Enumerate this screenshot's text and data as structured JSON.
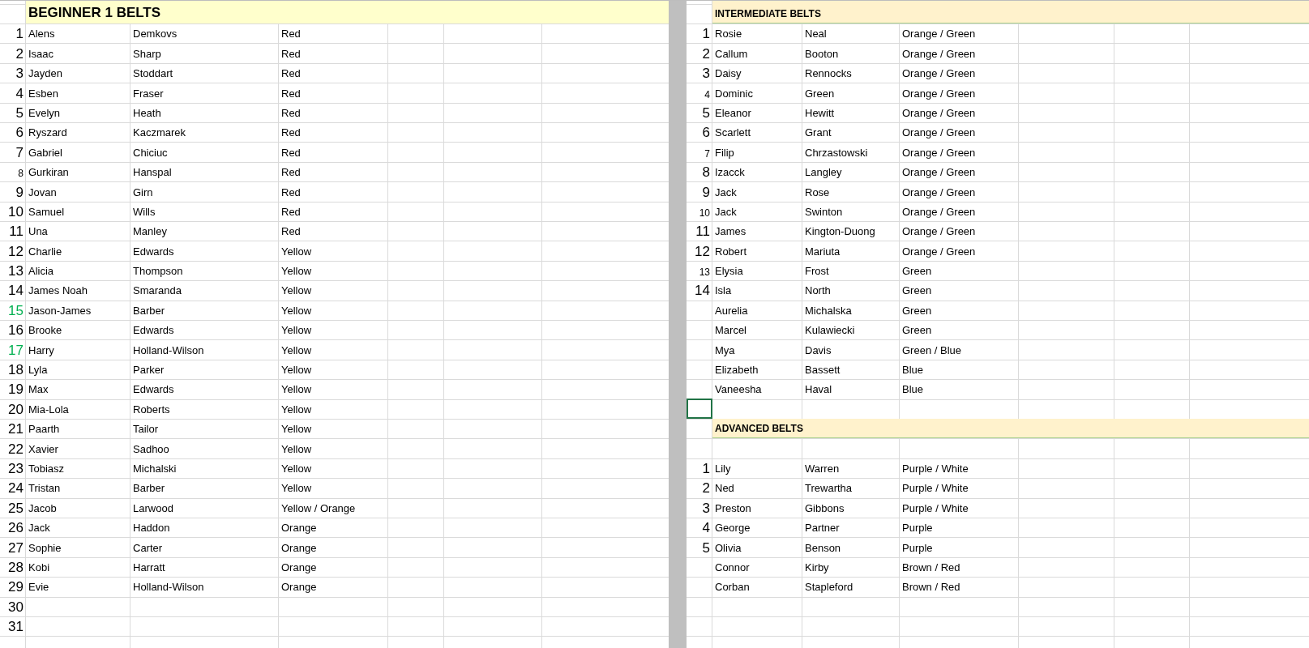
{
  "beginner": {
    "title": "BEGINNER 1 BELTS",
    "rows": [
      {
        "num": "1",
        "first": "Alens",
        "last": "Demkovs",
        "belt": "Red",
        "color": "#000000",
        "small": false
      },
      {
        "num": "2",
        "first": "Isaac",
        "last": "Sharp",
        "belt": "Red",
        "color": "#000000",
        "small": false
      },
      {
        "num": "3",
        "first": "Jayden",
        "last": "Stoddart",
        "belt": "Red",
        "color": "#000000",
        "small": false
      },
      {
        "num": "4",
        "first": "Esben",
        "last": "Fraser",
        "belt": "Red",
        "color": "#000000",
        "small": false
      },
      {
        "num": "5",
        "first": "Evelyn",
        "last": "Heath",
        "belt": "Red",
        "color": "#000000",
        "small": false
      },
      {
        "num": "6",
        "first": "Ryszard",
        "last": "Kaczmarek",
        "belt": "Red",
        "color": "#000000",
        "small": false
      },
      {
        "num": "7",
        "first": "Gabriel",
        "last": "Chiciuc",
        "belt": "Red",
        "color": "#000000",
        "small": false
      },
      {
        "num": "8",
        "first": "Gurkiran",
        "last": "Hanspal",
        "belt": "Red",
        "color": "#000000",
        "small": true
      },
      {
        "num": "9",
        "first": "Jovan",
        "last": "Girn",
        "belt": "Red",
        "color": "#000000",
        "small": false
      },
      {
        "num": "10",
        "first": "Samuel",
        "last": "Wills",
        "belt": "Red",
        "color": "#000000",
        "small": false
      },
      {
        "num": "11",
        "first": "Una",
        "last": "Manley",
        "belt": "Red",
        "color": "#000000",
        "small": false
      },
      {
        "num": "12",
        "first": "Charlie",
        "last": "Edwards",
        "belt": "Yellow",
        "color": "#000000",
        "small": false
      },
      {
        "num": "13",
        "first": "Alicia",
        "last": "Thompson",
        "belt": "Yellow",
        "color": "#000000",
        "small": false
      },
      {
        "num": "14",
        "first": "James Noah",
        "last": "Smaranda",
        "belt": "Yellow",
        "color": "#000000",
        "small": false
      },
      {
        "num": "15",
        "first": "Jason-James",
        "last": "Barber",
        "belt": "Yellow",
        "color": "#00b050",
        "small": false
      },
      {
        "num": "16",
        "first": "Brooke",
        "last": "Edwards",
        "belt": "Yellow",
        "color": "#000000",
        "small": false
      },
      {
        "num": "17",
        "first": "Harry",
        "last": "Holland-Wilson",
        "belt": "Yellow",
        "color": "#00b050",
        "small": false
      },
      {
        "num": "18",
        "first": "Lyla",
        "last": "Parker",
        "belt": "Yellow",
        "color": "#000000",
        "small": false
      },
      {
        "num": "19",
        "first": "Max",
        "last": "Edwards",
        "belt": "Yellow",
        "color": "#000000",
        "small": false
      },
      {
        "num": "20",
        "first": "Mia-Lola",
        "last": "Roberts",
        "belt": "Yellow",
        "color": "#000000",
        "small": false
      },
      {
        "num": "21",
        "first": "Paarth",
        "last": "Tailor",
        "belt": "Yellow",
        "color": "#000000",
        "small": false
      },
      {
        "num": "22",
        "first": "Xavier",
        "last": "Sadhoo",
        "belt": "Yellow",
        "color": "#000000",
        "small": false
      },
      {
        "num": "23",
        "first": "Tobiasz",
        "last": "Michalski",
        "belt": "Yellow",
        "color": "#000000",
        "small": false
      },
      {
        "num": "24",
        "first": "Tristan",
        "last": "Barber",
        "belt": "Yellow",
        "color": "#000000",
        "small": false
      },
      {
        "num": "25",
        "first": "Jacob",
        "last": "Larwood",
        "belt": "Yellow / Orange",
        "color": "#000000",
        "small": false
      },
      {
        "num": "26",
        "first": "Jack",
        "last": "Haddon",
        "belt": "Orange",
        "color": "#000000",
        "small": false
      },
      {
        "num": "27",
        "first": "Sophie",
        "last": "Carter",
        "belt": "Orange",
        "color": "#000000",
        "small": false
      },
      {
        "num": "28",
        "first": "Kobi",
        "last": "Harratt",
        "belt": "Orange",
        "color": "#000000",
        "small": false
      },
      {
        "num": "29",
        "first": "Evie",
        "last": "Holland-Wilson",
        "belt": "Orange",
        "color": "#000000",
        "small": false
      },
      {
        "num": "30",
        "color": "#000000",
        "small": false
      },
      {
        "num": "31",
        "color": "#000000",
        "small": false
      }
    ]
  },
  "intermediate": {
    "title": "INTERMEDIATE BELTS",
    "rows": [
      {
        "num": "1",
        "first": "Rosie",
        "last": "Neal",
        "belt": "Orange / Green",
        "small": false
      },
      {
        "num": "2",
        "first": "Callum",
        "last": "Booton",
        "belt": "Orange / Green",
        "small": false
      },
      {
        "num": "3",
        "first": "Daisy",
        "last": "Rennocks",
        "belt": "Orange / Green",
        "small": false
      },
      {
        "num": "4",
        "first": "Dominic",
        "last": "Green",
        "belt": "Orange / Green",
        "small": true
      },
      {
        "num": "5",
        "first": "Eleanor",
        "last": "Hewitt",
        "belt": "Orange / Green",
        "small": false
      },
      {
        "num": "6",
        "first": "Scarlett",
        "last": "Grant",
        "belt": "Orange / Green",
        "small": false
      },
      {
        "num": "7",
        "first": "Filip",
        "last": "Chrzastowski",
        "belt": "Orange / Green",
        "small": true
      },
      {
        "num": "8",
        "first": "Izacck",
        "last": "Langley",
        "belt": "Orange / Green",
        "small": false
      },
      {
        "num": "9",
        "first": "Jack",
        "last": "Rose",
        "belt": "Orange / Green",
        "small": false
      },
      {
        "num": "10",
        "first": "Jack",
        "last": "Swinton",
        "belt": "Orange / Green",
        "small": true
      },
      {
        "num": "11",
        "first": "James",
        "last": "Kington-Duong",
        "belt": "Orange / Green",
        "small": false
      },
      {
        "num": "12",
        "first": "Robert",
        "last": "Mariuta",
        "belt": "Orange / Green",
        "small": false
      },
      {
        "num": "13",
        "first": "Elysia",
        "last": "Frost",
        "belt": "Green",
        "small": true
      },
      {
        "num": "14",
        "first": "Isla",
        "last": "North",
        "belt": "Green",
        "small": false
      },
      {
        "first": "Aurelia",
        "last": "Michalska",
        "belt": "Green"
      },
      {
        "first": "Marcel",
        "last": "Kulawiecki",
        "belt": "Green"
      },
      {
        "first": "Mya",
        "last": "Davis",
        "belt": "Green / Blue"
      },
      {
        "first": "Elizabeth",
        "last": "Bassett",
        "belt": "Blue"
      },
      {
        "first": "Vaneesha",
        "last": "Haval",
        "belt": "Blue"
      }
    ],
    "blank_cell": {
      "selected": true
    }
  },
  "advanced": {
    "title": "ADVANCED BELTS",
    "rows": [
      {
        "num": "1",
        "first": "Lily",
        "last": "Warren",
        "belt": "Purple / White",
        "small": false
      },
      {
        "num": "2",
        "first": "Ned",
        "last": "Trewartha",
        "belt": "Purple / White",
        "small": false
      },
      {
        "num": "3",
        "first": "Preston",
        "last": "Gibbons",
        "belt": "Purple / White",
        "small": false
      },
      {
        "num": "4",
        "first": "George",
        "last": "Partner",
        "belt": "Purple",
        "small": false
      },
      {
        "num": "5",
        "first": "Olivia",
        "last": "Benson",
        "belt": "Purple",
        "small": false
      },
      {
        "first": "Connor",
        "last": "Kirby",
        "belt": "Brown / Red"
      },
      {
        "first": "Corban",
        "last": "Stapleford",
        "belt": "Brown / Red"
      }
    ]
  }
}
